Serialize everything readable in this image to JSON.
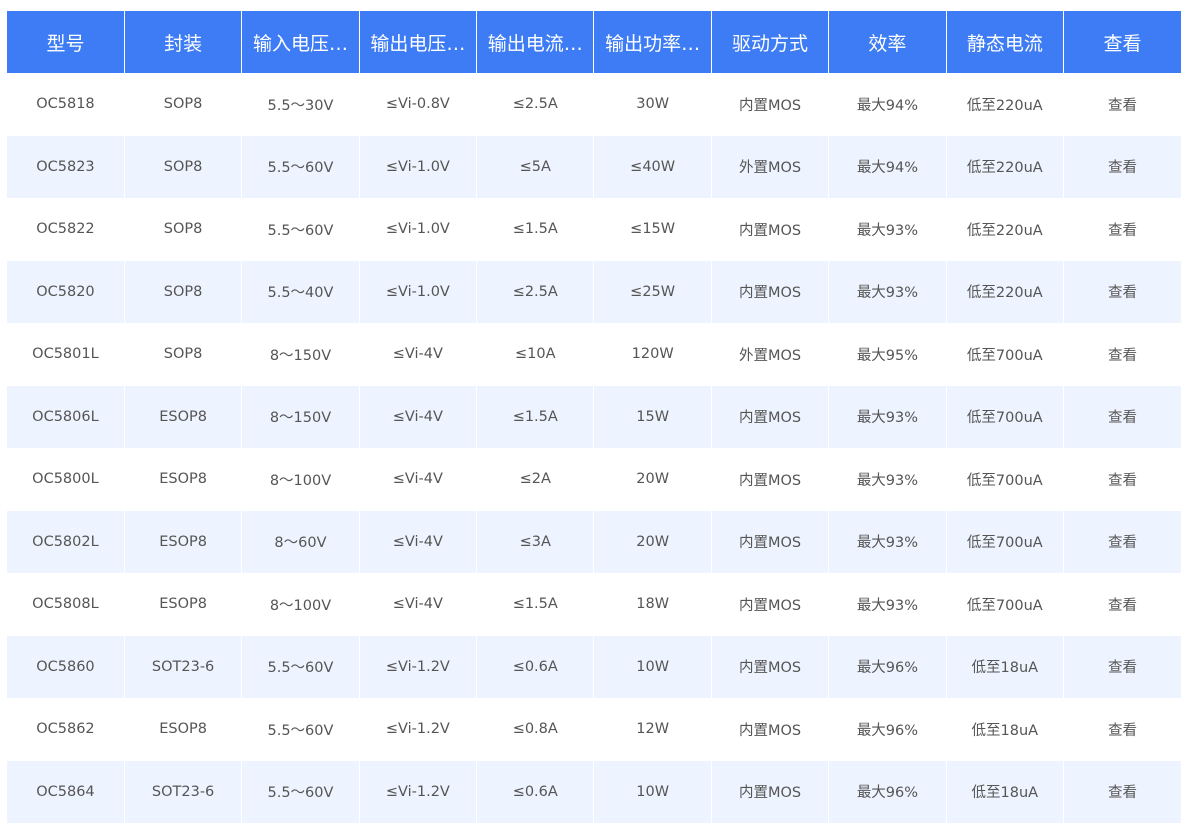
{
  "table": {
    "headers": [
      "型号",
      "封装",
      "输入电压…",
      "输出电压…",
      "输出电流…",
      "输出功率…",
      "驱动方式",
      "效率",
      "静态电流",
      "查看"
    ],
    "rows": [
      [
        "OC5818",
        "SOP8",
        "5.5～30V",
        "≤Vi-0.8V",
        "≤2.5A",
        "30W",
        "内置MOS",
        "最大94%",
        "低至220uA",
        "查看"
      ],
      [
        "OC5823",
        "SOP8",
        "5.5～60V",
        "≤Vi-1.0V",
        "≤5A",
        "≤40W",
        "外置MOS",
        "最大94%",
        "低至220uA",
        "查看"
      ],
      [
        "OC5822",
        "SOP8",
        "5.5～60V",
        "≤Vi-1.0V",
        "≤1.5A",
        "≤15W",
        "内置MOS",
        "最大93%",
        "低至220uA",
        "查看"
      ],
      [
        "OC5820",
        "SOP8",
        "5.5～40V",
        "≤Vi-1.0V",
        "≤2.5A",
        "≤25W",
        "内置MOS",
        "最大93%",
        "低至220uA",
        "查看"
      ],
      [
        "OC5801L",
        "SOP8",
        "8～150V",
        "≤Vi-4V",
        "≤10A",
        "120W",
        "外置MOS",
        "最大95%",
        "低至700uA",
        "查看"
      ],
      [
        "OC5806L",
        "ESOP8",
        "8～150V",
        "≤Vi-4V",
        "≤1.5A",
        "15W",
        "内置MOS",
        "最大93%",
        "低至700uA",
        "查看"
      ],
      [
        "OC5800L",
        "ESOP8",
        "8～100V",
        "≤Vi-4V",
        "≤2A",
        "20W",
        "内置MOS",
        "最大93%",
        "低至700uA",
        "查看"
      ],
      [
        "OC5802L",
        "ESOP8",
        "8～60V",
        "≤Vi-4V",
        "≤3A",
        "20W",
        "内置MOS",
        "最大93%",
        "低至700uA",
        "查看"
      ],
      [
        "OC5808L",
        "ESOP8",
        "8～100V",
        "≤Vi-4V",
        "≤1.5A",
        "18W",
        "内置MOS",
        "最大93%",
        "低至700uA",
        "查看"
      ],
      [
        "OC5860",
        "SOT23-6",
        "5.5～60V",
        "≤Vi-1.2V",
        "≤0.6A",
        "10W",
        "内置MOS",
        "最大96%",
        "低至18uA",
        "查看"
      ],
      [
        "OC5862",
        "ESOP8",
        "5.5～60V",
        "≤Vi-1.2V",
        "≤0.8A",
        "12W",
        "内置MOS",
        "最大96%",
        "低至18uA",
        "查看"
      ],
      [
        "OC5864",
        "SOT23-6",
        "5.5～60V",
        "≤Vi-1.2V",
        "≤0.6A",
        "10W",
        "内置MOS",
        "最大96%",
        "低至18uA",
        "查看"
      ]
    ]
  },
  "colors": {
    "header_bg": "#3d7cf5",
    "header_text": "#ffffff",
    "row_alt_bg": "#eef4ff",
    "cell_text": "#555555"
  }
}
